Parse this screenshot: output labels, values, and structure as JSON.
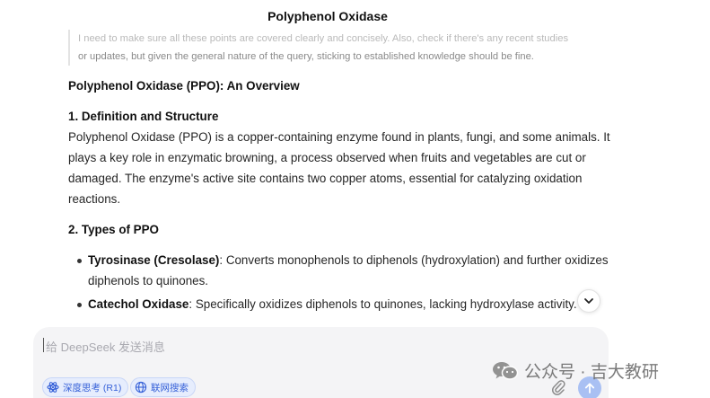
{
  "chat": {
    "title": "Polyphenol Oxidase",
    "thought_lines": [
      "I need to make sure all these points are covered clearly and concisely. Also, check if there's any recent studies",
      "or updates, but given the general nature of the query, sticking to established knowledge should be fine."
    ],
    "answer": {
      "heading": "Polyphenol Oxidase (PPO): An Overview",
      "section1_heading": "1. Definition and Structure",
      "section1_body": "Polyphenol Oxidase (PPO) is a copper-containing enzyme found in plants, fungi, and some animals. It plays a key role in enzymatic browning, a process observed when fruits and vegetables are cut or damaged. The enzyme's active site contains two copper atoms, essential for catalyzing oxidation reactions.",
      "section2_heading": "2. Types of PPO",
      "bullets": [
        {
          "term": "Tyrosinase (Cresolase)",
          "text": ": Converts monophenols to diphenols (hydroxylation) and further oxidizes diphenols to quinones."
        },
        {
          "term": "Catechol Oxidase",
          "text": ": Specifically oxidizes diphenols to quinones, lacking hydroxylase activity."
        }
      ]
    },
    "scroll_down_icon": "chevron-down-icon"
  },
  "composer": {
    "placeholder": "给 DeepSeek 发送消息",
    "deep_think_label": "深度思考 (R1)",
    "deep_think_icon": "atom-icon",
    "web_search_label": "联网搜索",
    "web_search_icon": "globe-icon",
    "attach_icon": "paperclip-icon",
    "send_icon": "arrow-up-icon"
  },
  "watermark": {
    "text": "公众号 · 吉大教研",
    "icon": "wechat-icon"
  },
  "colors": {
    "accent": "#3560d8",
    "chip_bg": "#e6edfd",
    "send_bg": "#a9c0f3",
    "composer_bg": "#f4f4f6"
  }
}
